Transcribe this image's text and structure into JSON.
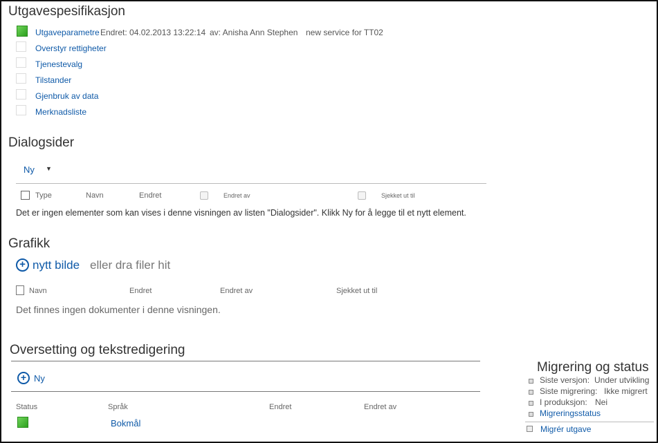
{
  "spec": {
    "title": "Utgavespesifikasjon",
    "items": [
      {
        "label": "Utgaveparametre",
        "done": true
      },
      {
        "label": "Overstyr rettigheter",
        "done": false
      },
      {
        "label": "Tjenestevalg",
        "done": false
      },
      {
        "label": "Tilstander",
        "done": false
      },
      {
        "label": "Gjenbruk av data",
        "done": false
      },
      {
        "label": "Merknadsliste",
        "done": false
      }
    ],
    "meta_changed": "Endret: 04.02.2013 13:22:14",
    "meta_by": "av: Anisha Ann Stephen",
    "meta_note": "new service for TT02"
  },
  "dialog": {
    "title": "Dialogsider",
    "new_label": "Ny",
    "columns": [
      "Type",
      "Navn",
      "Endret",
      "Endret av",
      "Sjekket ut til"
    ],
    "empty_text": "Det er ingen elementer som kan vises i denne visningen av listen \"Dialogsider\". Klikk Ny for å legge til et nytt element."
  },
  "graphics": {
    "title": "Grafikk",
    "new_link": "nytt bilde",
    "drag_text": "eller dra filer hit",
    "columns": [
      "Navn",
      "Endret",
      "Endret av",
      "Sjekket ut til"
    ],
    "empty_text": "Det finnes ingen dokumenter i denne visningen."
  },
  "translation": {
    "title": "Oversetting og tekstredigering",
    "new_label": "Ny",
    "columns": [
      "Status",
      "Språk",
      "Endret",
      "Endret av"
    ],
    "rows": [
      {
        "language": "Bokmål",
        "status_color": "#3cb82a"
      }
    ]
  },
  "migration": {
    "title": "Migrering og status",
    "rows": [
      {
        "label": "Siste versjon:",
        "value": "Under utvikling"
      },
      {
        "label": "Siste migrering:",
        "value": "Ikke migrert"
      },
      {
        "label": "I produksjon:",
        "value": "Nei"
      }
    ],
    "status_link": "Migreringsstatus",
    "migrate_link": "Migrér utgave"
  }
}
